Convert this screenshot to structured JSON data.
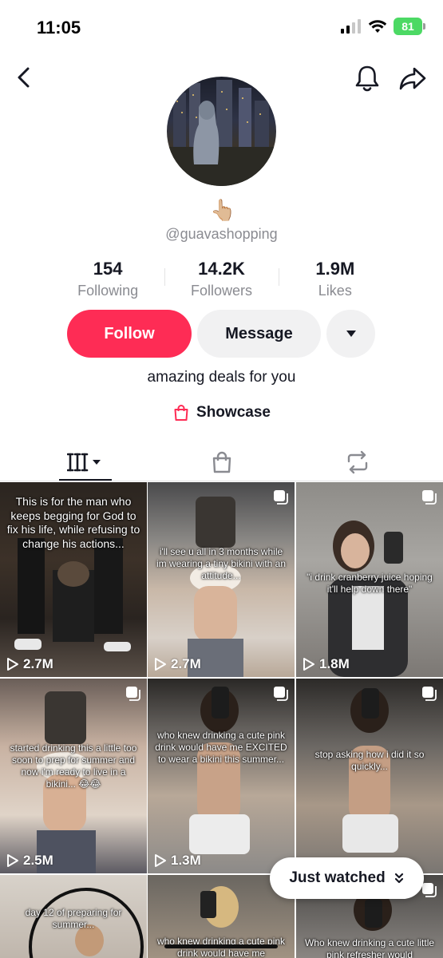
{
  "status_bar": {
    "time": "11:05",
    "battery": "81"
  },
  "profile": {
    "emoji": "👆🏼",
    "handle": "@guavashopping",
    "stats": [
      {
        "value": "154",
        "label": "Following"
      },
      {
        "value": "14.2K",
        "label": "Followers"
      },
      {
        "value": "1.9M",
        "label": "Likes"
      }
    ],
    "follow_label": "Follow",
    "message_label": "Message",
    "bio": "amazing deals for you",
    "showcase_label": "Showcase"
  },
  "tabs": [
    {
      "icon": "videos-grid-icon",
      "active": true
    },
    {
      "icon": "shopping-bag-icon",
      "active": false
    },
    {
      "icon": "repost-icon",
      "active": false
    }
  ],
  "videos": [
    {
      "caption": "This is for the man who keeps begging for God to fix his life, while refusing to change his actions...",
      "views": "2.7M"
    },
    {
      "caption": "i'll see u all in 3 months while im wearing a tiny bikini with an attitude...",
      "views": "2.7M"
    },
    {
      "caption": "\"i drink cranberry juice hoping it'll help down there\"",
      "views": "1.8M"
    },
    {
      "caption": "started drinking this a little too soon to prep for summer and now i'm ready to live in a bikini... 😂😂",
      "views": "2.5M"
    },
    {
      "caption": "who knew drinking a cute pink drink would have me EXCITED to wear a bikini this summer...",
      "views": "1.3M"
    },
    {
      "caption": "stop asking how i did it so quickly...",
      "views": ""
    },
    {
      "caption": "day 12 of preparing for summer...",
      "views": ""
    },
    {
      "caption": "who knew drinking a cute pink drink would have me",
      "views": ""
    },
    {
      "caption": "Who knew drinking a cute little pink refresher would",
      "views": ""
    }
  ],
  "just_watched_label": "Just watched",
  "colors": {
    "accent": "#fe2c55",
    "text": "#161823",
    "muted": "#8a8b91",
    "button_gray": "#f1f1f2",
    "battery": "#4cd964"
  }
}
